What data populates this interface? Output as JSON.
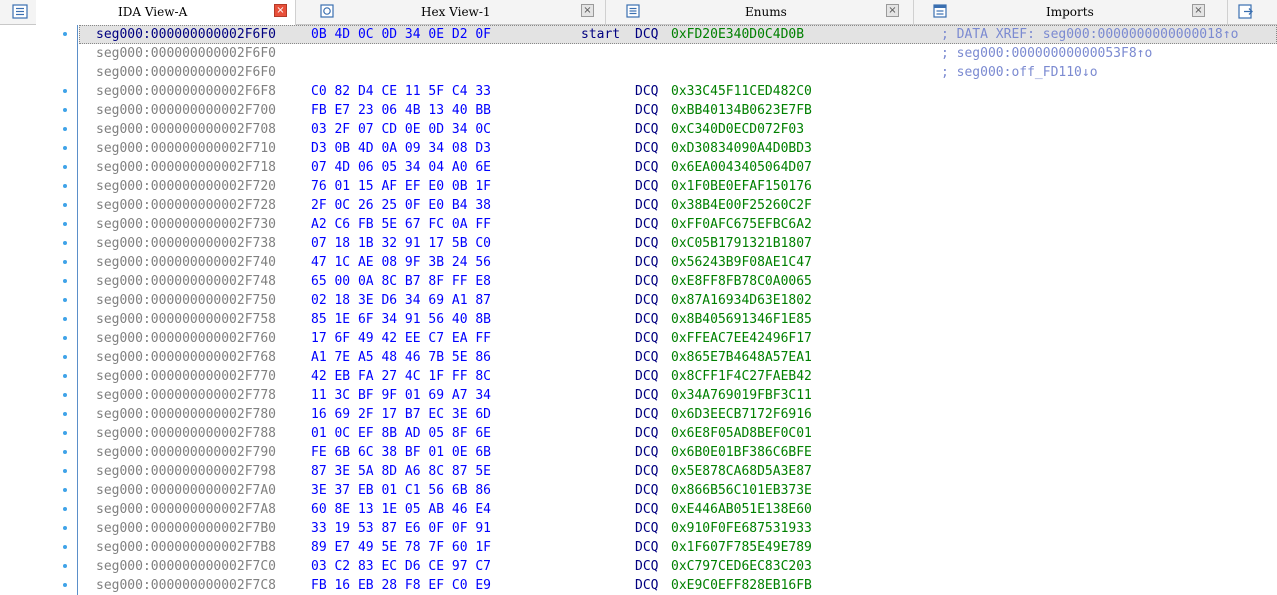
{
  "tabs": [
    {
      "label": "IDA View-A",
      "icon": "ida-view-icon",
      "active": true
    },
    {
      "label": "Hex View-1",
      "icon": "hex-view-icon",
      "active": false
    },
    {
      "label": "Enums",
      "icon": "enums-icon",
      "active": false
    },
    {
      "label": "Imports",
      "icon": "imports-icon",
      "active": false
    }
  ],
  "close_glyph": "×",
  "colors": {
    "address": "#808080",
    "bytes": "#0000ff",
    "mnemonic": "#000080",
    "operand": "#008000",
    "comment": "#7b8ad1",
    "active_close": "#e8503a"
  },
  "listing": {
    "rows": [
      {
        "addr": "seg000:000000000002F6F0",
        "bytes": "0B 4D 0C 0D 34 0E D2 0F",
        "label": "start",
        "mnem": "DCQ",
        "operand": "0xFD20E340D0C4D0B",
        "comment": "; DATA XREF: seg000:0000000000000018↑o",
        "dot": true,
        "current": true
      },
      {
        "addr": "seg000:000000000002F6F0",
        "bytes": "",
        "label": "",
        "mnem": "",
        "operand": "",
        "comment": "; seg000:00000000000053F8↑o",
        "dot": false,
        "current": false
      },
      {
        "addr": "seg000:000000000002F6F0",
        "bytes": "",
        "label": "",
        "mnem": "",
        "operand": "",
        "comment": "; seg000:off_FD110↓o",
        "dot": false,
        "current": false
      },
      {
        "addr": "seg000:000000000002F6F8",
        "bytes": "C0 82 D4 CE 11 5F C4 33",
        "label": "",
        "mnem": "DCQ",
        "operand": "0x33C45F11CED482C0",
        "comment": "",
        "dot": true,
        "current": false
      },
      {
        "addr": "seg000:000000000002F700",
        "bytes": "FB E7 23 06 4B 13 40 BB",
        "label": "",
        "mnem": "DCQ",
        "operand": "0xBB40134B0623E7FB",
        "comment": "",
        "dot": true,
        "current": false
      },
      {
        "addr": "seg000:000000000002F708",
        "bytes": "03 2F 07 CD 0E 0D 34 0C",
        "label": "",
        "mnem": "DCQ",
        "operand": "0xC340D0ECD072F03",
        "comment": "",
        "dot": true,
        "current": false
      },
      {
        "addr": "seg000:000000000002F710",
        "bytes": "D3 0B 4D 0A 09 34 08 D3",
        "label": "",
        "mnem": "DCQ",
        "operand": "0xD30834090A4D0BD3",
        "comment": "",
        "dot": true,
        "current": false
      },
      {
        "addr": "seg000:000000000002F718",
        "bytes": "07 4D 06 05 34 04 A0 6E",
        "label": "",
        "mnem": "DCQ",
        "operand": "0x6EA0043405064D07",
        "comment": "",
        "dot": true,
        "current": false
      },
      {
        "addr": "seg000:000000000002F720",
        "bytes": "76 01 15 AF EF E0 0B 1F",
        "label": "",
        "mnem": "DCQ",
        "operand": "0x1F0BE0EFAF150176",
        "comment": "",
        "dot": true,
        "current": false
      },
      {
        "addr": "seg000:000000000002F728",
        "bytes": "2F 0C 26 25 0F E0 B4 38",
        "label": "",
        "mnem": "DCQ",
        "operand": "0x38B4E00F25260C2F",
        "comment": "",
        "dot": true,
        "current": false
      },
      {
        "addr": "seg000:000000000002F730",
        "bytes": "A2 C6 FB 5E 67 FC 0A FF",
        "label": "",
        "mnem": "DCQ",
        "operand": "0xFF0AFC675EFBC6A2",
        "comment": "",
        "dot": true,
        "current": false
      },
      {
        "addr": "seg000:000000000002F738",
        "bytes": "07 18 1B 32 91 17 5B C0",
        "label": "",
        "mnem": "DCQ",
        "operand": "0xC05B1791321B1807",
        "comment": "",
        "dot": true,
        "current": false
      },
      {
        "addr": "seg000:000000000002F740",
        "bytes": "47 1C AE 08 9F 3B 24 56",
        "label": "",
        "mnem": "DCQ",
        "operand": "0x56243B9F08AE1C47",
        "comment": "",
        "dot": true,
        "current": false
      },
      {
        "addr": "seg000:000000000002F748",
        "bytes": "65 00 0A 8C B7 8F FF E8",
        "label": "",
        "mnem": "DCQ",
        "operand": "0xE8FF8FB78C0A0065",
        "comment": "",
        "dot": true,
        "current": false
      },
      {
        "addr": "seg000:000000000002F750",
        "bytes": "02 18 3E D6 34 69 A1 87",
        "label": "",
        "mnem": "DCQ",
        "operand": "0x87A16934D63E1802",
        "comment": "",
        "dot": true,
        "current": false
      },
      {
        "addr": "seg000:000000000002F758",
        "bytes": "85 1E 6F 34 91 56 40 8B",
        "label": "",
        "mnem": "DCQ",
        "operand": "0x8B405691346F1E85",
        "comment": "",
        "dot": true,
        "current": false
      },
      {
        "addr": "seg000:000000000002F760",
        "bytes": "17 6F 49 42 EE C7 EA FF",
        "label": "",
        "mnem": "DCQ",
        "operand": "0xFFEAC7EE42496F17",
        "comment": "",
        "dot": true,
        "current": false
      },
      {
        "addr": "seg000:000000000002F768",
        "bytes": "A1 7E A5 48 46 7B 5E 86",
        "label": "",
        "mnem": "DCQ",
        "operand": "0x865E7B4648A57EA1",
        "comment": "",
        "dot": true,
        "current": false
      },
      {
        "addr": "seg000:000000000002F770",
        "bytes": "42 EB FA 27 4C 1F FF 8C",
        "label": "",
        "mnem": "DCQ",
        "operand": "0x8CFF1F4C27FAEB42",
        "comment": "",
        "dot": true,
        "current": false
      },
      {
        "addr": "seg000:000000000002F778",
        "bytes": "11 3C BF 9F 01 69 A7 34",
        "label": "",
        "mnem": "DCQ",
        "operand": "0x34A769019FBF3C11",
        "comment": "",
        "dot": true,
        "current": false
      },
      {
        "addr": "seg000:000000000002F780",
        "bytes": "16 69 2F 17 B7 EC 3E 6D",
        "label": "",
        "mnem": "DCQ",
        "operand": "0x6D3EECB7172F6916",
        "comment": "",
        "dot": true,
        "current": false
      },
      {
        "addr": "seg000:000000000002F788",
        "bytes": "01 0C EF 8B AD 05 8F 6E",
        "label": "",
        "mnem": "DCQ",
        "operand": "0x6E8F05AD8BEF0C01",
        "comment": "",
        "dot": true,
        "current": false
      },
      {
        "addr": "seg000:000000000002F790",
        "bytes": "FE 6B 6C 38 BF 01 0E 6B",
        "label": "",
        "mnem": "DCQ",
        "operand": "0x6B0E01BF386C6BFE",
        "comment": "",
        "dot": true,
        "current": false
      },
      {
        "addr": "seg000:000000000002F798",
        "bytes": "87 3E 5A 8D A6 8C 87 5E",
        "label": "",
        "mnem": "DCQ",
        "operand": "0x5E878CA68D5A3E87",
        "comment": "",
        "dot": true,
        "current": false
      },
      {
        "addr": "seg000:000000000002F7A0",
        "bytes": "3E 37 EB 01 C1 56 6B 86",
        "label": "",
        "mnem": "DCQ",
        "operand": "0x866B56C101EB373E",
        "comment": "",
        "dot": true,
        "current": false
      },
      {
        "addr": "seg000:000000000002F7A8",
        "bytes": "60 8E 13 1E 05 AB 46 E4",
        "label": "",
        "mnem": "DCQ",
        "operand": "0xE446AB051E138E60",
        "comment": "",
        "dot": true,
        "current": false
      },
      {
        "addr": "seg000:000000000002F7B0",
        "bytes": "33 19 53 87 E6 0F 0F 91",
        "label": "",
        "mnem": "DCQ",
        "operand": "0x910F0FE687531933",
        "comment": "",
        "dot": true,
        "current": false
      },
      {
        "addr": "seg000:000000000002F7B8",
        "bytes": "89 E7 49 5E 78 7F 60 1F",
        "label": "",
        "mnem": "DCQ",
        "operand": "0x1F607F785E49E789",
        "comment": "",
        "dot": true,
        "current": false
      },
      {
        "addr": "seg000:000000000002F7C0",
        "bytes": "03 C2 83 EC D6 CE 97 C7",
        "label": "",
        "mnem": "DCQ",
        "operand": "0xC797CED6EC83C203",
        "comment": "",
        "dot": true,
        "current": false
      },
      {
        "addr": "seg000:000000000002F7C8",
        "bytes": "FB 16 EB 28 F8 EF C0 E9",
        "label": "",
        "mnem": "DCQ",
        "operand": "0xE9C0EFF828EB16FB",
        "comment": "",
        "dot": true,
        "current": false
      }
    ]
  }
}
